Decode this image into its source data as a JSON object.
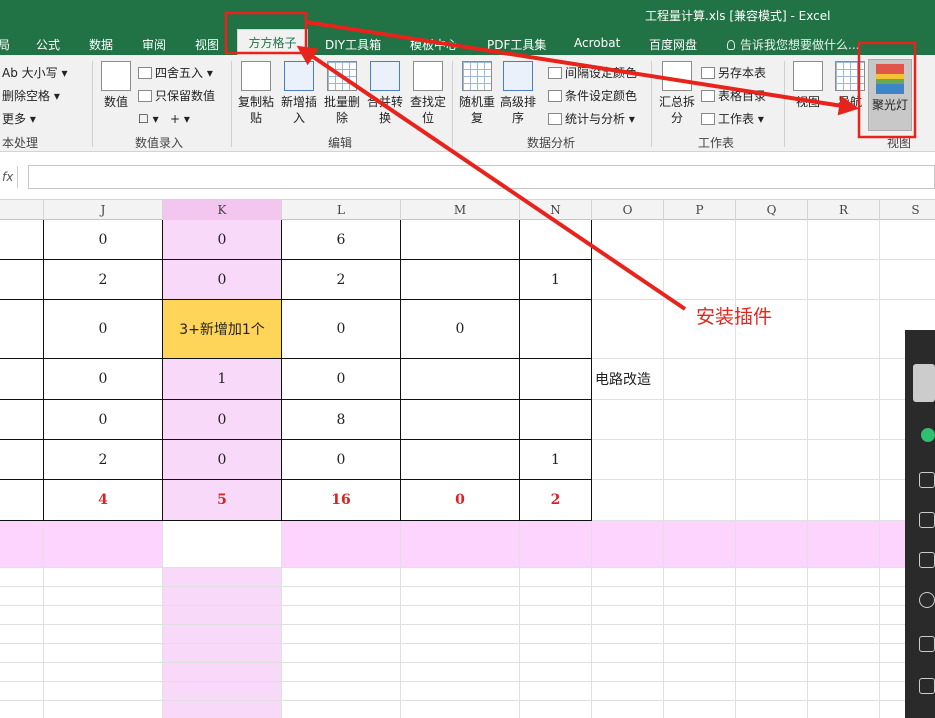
{
  "window": {
    "title": "工程量计算.xls  [兼容模式] - Excel"
  },
  "tabs": [
    {
      "label": "局"
    },
    {
      "label": "公式"
    },
    {
      "label": "数据"
    },
    {
      "label": "审阅"
    },
    {
      "label": "视图"
    },
    {
      "label": "方方格子"
    },
    {
      "label": "DIY工具箱"
    },
    {
      "label": "模板中心"
    },
    {
      "label": "PDF工具集"
    },
    {
      "label": "Acrobat"
    },
    {
      "label": "百度网盘"
    }
  ],
  "tellme": "告诉我您想要做什么...",
  "ribbon": {
    "text_group": {
      "items": [
        "Ab 大小写",
        "删除空格",
        "更多"
      ],
      "label": "本处理"
    },
    "value_group": {
      "big": "数值",
      "items": [
        "四舍五入",
        "只保留数值"
      ],
      "label": "数值录入"
    },
    "edit_group": {
      "buttons": [
        "复制粘贴",
        "新增插入",
        "批量删除",
        "合并转换",
        "查找定位"
      ],
      "label": "编辑"
    },
    "analysis_group": {
      "buttons": [
        "随机重复",
        "高级排序"
      ],
      "items": [
        "间隔设定颜色",
        "条件设定颜色",
        "统计与分析"
      ],
      "label": "数据分析"
    },
    "sheet_group": {
      "big": "汇总拆分",
      "items": [
        "另存本表",
        "表格目录",
        "工作表"
      ],
      "label": "工作表"
    },
    "view_group": {
      "buttons": [
        "视图",
        "导航",
        "聚光灯"
      ],
      "label": "视图"
    }
  },
  "formula_bar": {
    "fx": "fx",
    "value": ""
  },
  "columns": [
    "J",
    "K",
    "L",
    "M",
    "N",
    "O",
    "P",
    "Q",
    "R",
    "S"
  ],
  "rows": [
    [
      "0",
      "0",
      "6",
      "",
      ""
    ],
    [
      "2",
      "0",
      "2",
      "",
      "1"
    ],
    [
      "0",
      "3+新增加1个",
      "0",
      "0",
      ""
    ],
    [
      "0",
      "1",
      "0",
      "",
      ""
    ],
    [
      "0",
      "0",
      "8",
      "",
      ""
    ],
    [
      "2",
      "0",
      "0",
      "",
      "1"
    ]
  ],
  "totals": [
    "4",
    "5",
    "16",
    "0",
    "2"
  ],
  "note_cell": "电路改造",
  "annotation": "安装插件",
  "colors": {
    "excel_green": "#217346",
    "highlight_pink": "#f9d9f9",
    "yellow_cell": "#ffd559",
    "annotation_red": "#e8231b"
  }
}
